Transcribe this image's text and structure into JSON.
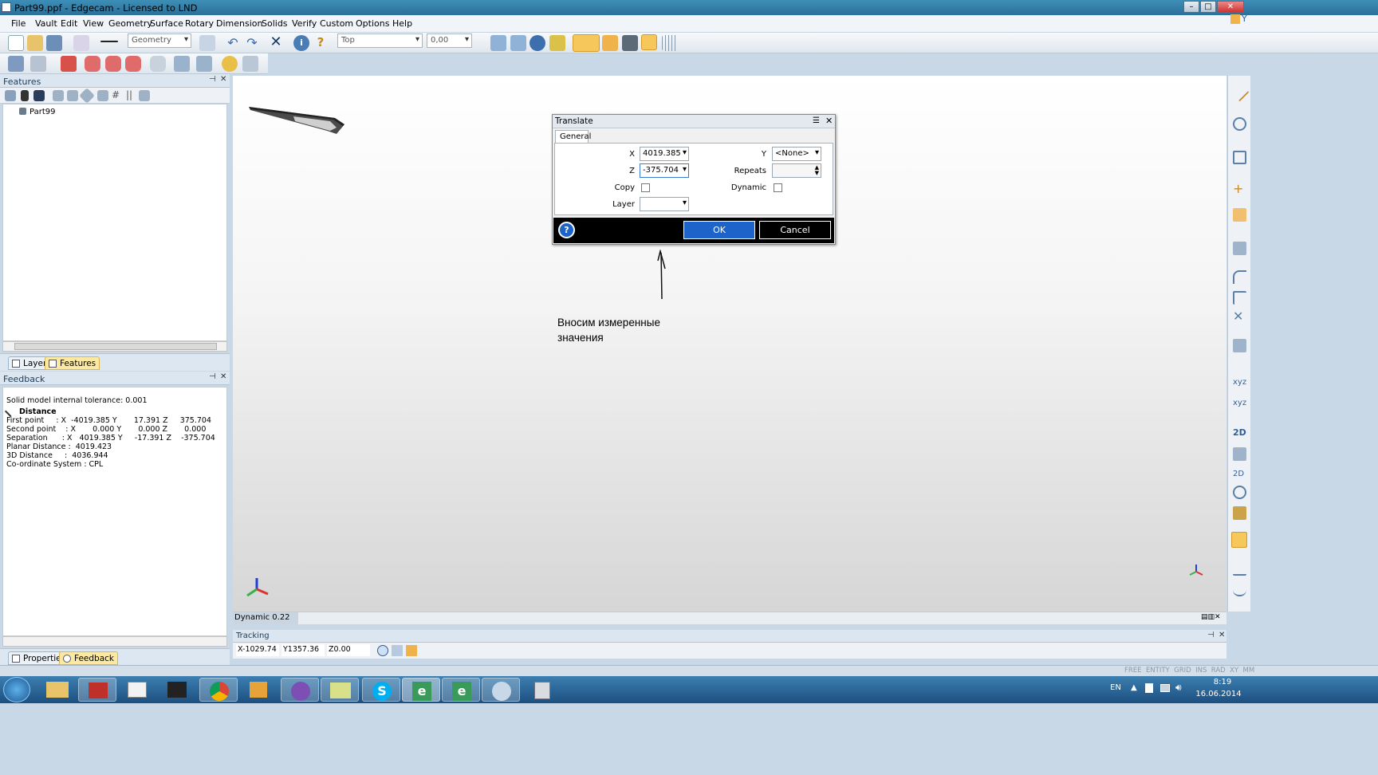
{
  "window": {
    "title": "Part99.ppf - Edgecam - Licensed to LND"
  },
  "menu": [
    "File",
    "Vault",
    "Edit",
    "View",
    "Geometry",
    "Surface",
    "Rotary",
    "Dimension",
    "Solids",
    "Verify",
    "Custom",
    "Options",
    "Help"
  ],
  "toolbar": {
    "mode_combo": "Geometry",
    "view_combo": "Top",
    "value_combo": "0,00"
  },
  "features_panel": {
    "title": "Features",
    "tree_item": "Part99",
    "tabs": [
      "Layers",
      "Features"
    ]
  },
  "feedback_panel": {
    "title": "Feedback",
    "lines": [
      "Solid model internal tolerance: 0.001",
      "Distance",
      "First point     : X  -4019.385 Y       17.391 Z     375.704",
      "Second point    : X       0.000 Y       0.000 Z       0.000",
      "Separation      : X   4019.385 Y     -17.391 Z    -375.704",
      "Planar Distance :  4019.423",
      "3D Distance     :  4036.944",
      "Co-ordinate System : CPL"
    ],
    "tabs": [
      "Properties",
      "Feedback"
    ]
  },
  "dialog": {
    "title": "Translate",
    "tab": "General",
    "x_label": "X",
    "x_value": "4019.385",
    "y_label": "Y",
    "y_value": "<None>",
    "z_label": "Z",
    "z_value": "-375.704",
    "repeats_label": "Repeats",
    "repeats_value": "",
    "copy_label": "Copy",
    "dynamic_label": "Dynamic",
    "layer_label": "Layer",
    "layer_value": "",
    "ok_label": "OK",
    "cancel_label": "Cancel"
  },
  "annotation": {
    "line1": "Вносим измеренные",
    "line2": "значения"
  },
  "canvas_status": {
    "dynamic": "Dynamic 0.22"
  },
  "tracking": {
    "title": "Tracking",
    "x": "X-1029.74",
    "y": "Y1357.36",
    "z": "Z0.00"
  },
  "statusbar": {
    "items": "FREE  ENTITY  GRID  INS  RAD  XY  MM"
  },
  "tray": {
    "lang": "EN",
    "time": "8:19",
    "date": "16.06.2014"
  },
  "colors": {
    "accent": "#1e63c9",
    "titlebar": "#2b6f99",
    "taskbar": "#1c4f80"
  }
}
